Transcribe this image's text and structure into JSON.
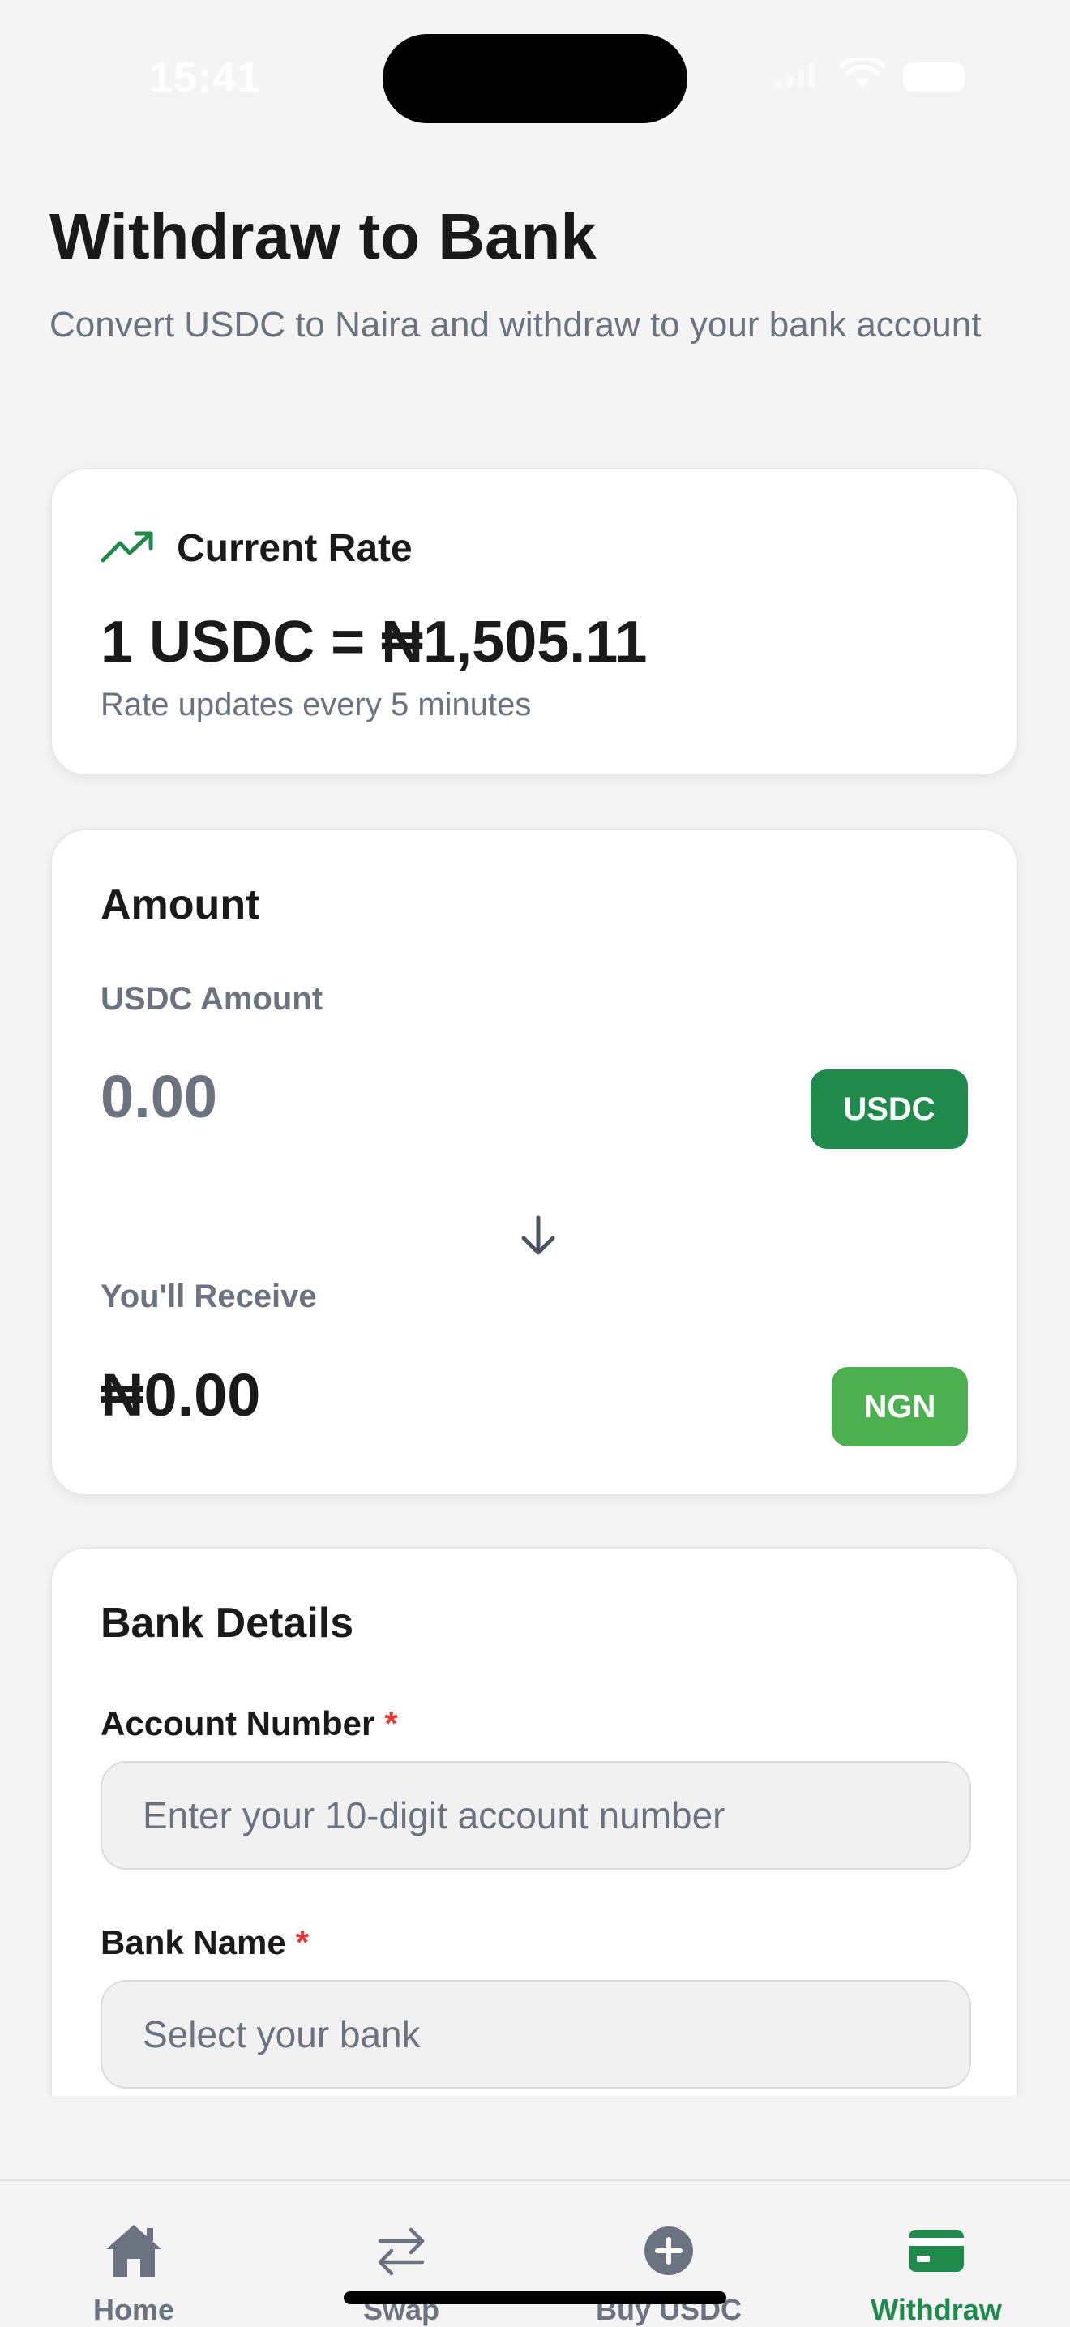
{
  "status_bar": {
    "time": "15:41"
  },
  "header": {
    "title": "Withdraw to Bank",
    "subtitle": "Convert USDC to Naira and withdraw to your bank account"
  },
  "rate_card": {
    "icon": "trending-up-icon",
    "label": "Current Rate",
    "value": "1 USDC = ₦1,505.11",
    "note": "Rate updates every 5 minutes"
  },
  "amount_card": {
    "title": "Amount",
    "usdc_label": "USDC Amount",
    "usdc_value": "0.00",
    "usdc_pill": "USDC",
    "receive_label": "You'll Receive",
    "receive_value": "₦0.00",
    "ngn_pill": "NGN"
  },
  "bank_card": {
    "title": "Bank Details",
    "account_label": "Account Number",
    "account_placeholder": "Enter your 10-digit account number",
    "bank_label": "Bank Name",
    "bank_placeholder": "Select your bank",
    "required_mark": "*"
  },
  "tab_bar": {
    "tabs": [
      {
        "label": "Home",
        "icon": "home-icon",
        "active": false
      },
      {
        "label": "Swap",
        "icon": "swap-icon",
        "active": false
      },
      {
        "label": "Buy USDC",
        "icon": "plus-circle-icon",
        "active": false
      },
      {
        "label": "Withdraw",
        "icon": "card-icon",
        "active": true
      }
    ]
  },
  "colors": {
    "brand_green": "#1f8a4c",
    "ngn_green": "#4caf50",
    "muted_text": "#6b7280",
    "required_red": "#e53935"
  }
}
